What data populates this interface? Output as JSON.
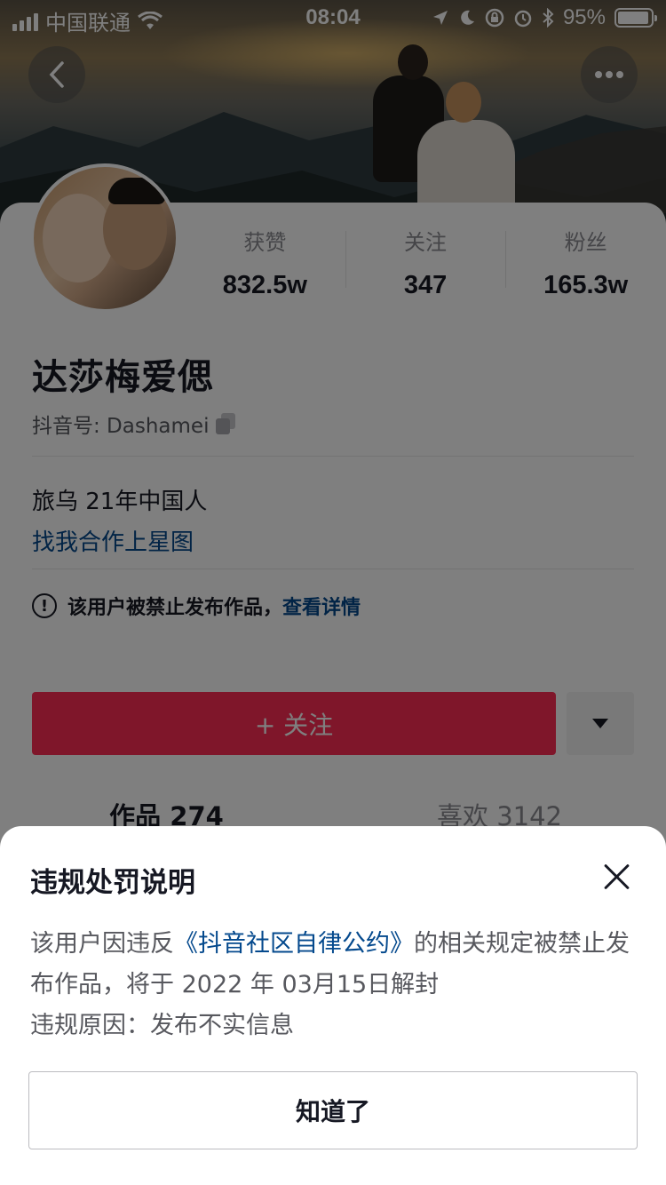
{
  "status_bar": {
    "carrier": "中国联通",
    "time": "08:04",
    "battery": "95%",
    "battery_level": 0.95
  },
  "header": {
    "back_icon": "chevron-left-icon",
    "more_icon": "more-horizontal-icon"
  },
  "profile": {
    "stats": [
      {
        "label": "获赞",
        "value": "832.5w"
      },
      {
        "label": "关注",
        "value": "347"
      },
      {
        "label": "粉丝",
        "value": "165.3w"
      }
    ],
    "nickname": "达莎梅爱偲",
    "douyin_id": "抖音号: Dashamei",
    "bio": "旅乌 21年中国人",
    "bio_link": "找我合作上星图",
    "notice_text": "该用户被禁止发布作品，",
    "notice_link": "查看详情",
    "follow_label": "+ 关注"
  },
  "tabs": [
    {
      "label": "作品 274"
    },
    {
      "label": "喜欢 3142"
    }
  ],
  "sheet": {
    "title": "违规处罚说明",
    "body_prefix": "该用户因违反",
    "body_link": "《抖音社区自律公约》",
    "body_suffix": "的相关规定被禁止发布作品，将于 2022 年 03月15日解封",
    "reason": "违规原因：发布不实信息",
    "ok_label": "知道了"
  },
  "colors": {
    "accent": "#fe2c55",
    "link": "#04498d",
    "text": "#161823"
  }
}
